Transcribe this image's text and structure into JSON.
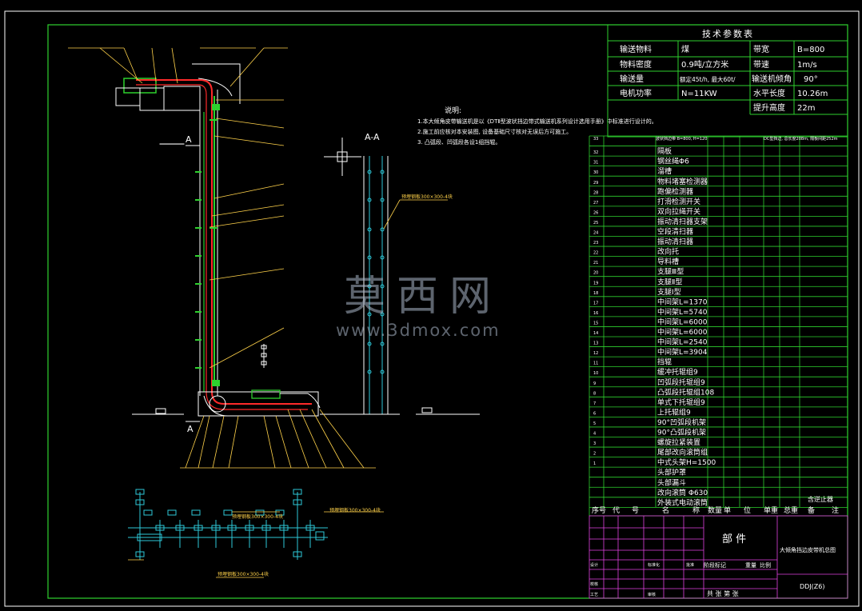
{
  "tech_table": {
    "title": "技术参数表",
    "rows": [
      {
        "k1": "输送物料",
        "v1": "煤",
        "k2": "带宽",
        "v2": "B=800"
      },
      {
        "k1": "物料密度",
        "v1": "0.9吨/立方米",
        "k2": "带速",
        "v2": "1m/s"
      },
      {
        "k1": "输送量",
        "v1": "额定45t/h, 最大60t/",
        "k2": "输送机倾角",
        "v2": "90°"
      },
      {
        "k1": "电机功率",
        "v1": "N=11KW",
        "k2": "水平长度",
        "v2": "10.26m"
      },
      {
        "k1": "",
        "v1": "",
        "k2": "提升高度",
        "v2": "22m"
      }
    ]
  },
  "notes": {
    "title": "说明:",
    "lines": [
      "1.本大倾角皮带输送机是以《DTⅡ型波状挡边带式输送机系列设计选用手册》中标准进行设计的。",
      "2.施工前应核对本安装图, 设备基础尺寸核对无误后方可施工。",
      "3. 凸弧段、凹弧段各设1组挡辊。"
    ]
  },
  "section_label": "A-A",
  "section_marks": [
    "A",
    "A"
  ],
  "annotations": [
    "预埋钢板300×300-4块",
    "预埋钢板300×300-4块",
    "预埋钢板300×300-4块",
    "预埋钢板300×300-4块"
  ],
  "bom": {
    "head_row": {
      "no": "33",
      "name": "波状挡边带 B=800, H=120",
      "remark": "DC型挡边, 总长度208m, 隔板间距252m"
    },
    "items": [
      {
        "no": "32",
        "name": "隔板"
      },
      {
        "no": "31",
        "name": "钢丝绳Φ6"
      },
      {
        "no": "30",
        "name": "溜槽"
      },
      {
        "no": "29",
        "name": "物料堵塞检测器"
      },
      {
        "no": "28",
        "name": "跑偏检测器"
      },
      {
        "no": "27",
        "name": "打滑检测开关"
      },
      {
        "no": "26",
        "name": "双向拉绳开关"
      },
      {
        "no": "25",
        "name": "振动清扫器支架"
      },
      {
        "no": "24",
        "name": "空段清扫器"
      },
      {
        "no": "23",
        "name": "振动清扫器"
      },
      {
        "no": "22",
        "name": "改向托"
      },
      {
        "no": "21",
        "name": "导料槽"
      },
      {
        "no": "20",
        "name": "支腿Ⅲ型"
      },
      {
        "no": "19",
        "name": "支腿Ⅱ型"
      },
      {
        "no": "18",
        "name": "支腿Ⅰ型"
      },
      {
        "no": "17",
        "name": "中间架L=1370"
      },
      {
        "no": "16",
        "name": "中间架L=5740"
      },
      {
        "no": "15",
        "name": "中间架L=6000"
      },
      {
        "no": "14",
        "name": "中间架L=6000"
      },
      {
        "no": "13",
        "name": "中间架L=2540"
      },
      {
        "no": "12",
        "name": "中间架L=3904"
      },
      {
        "no": "11",
        "name": "挡辊"
      },
      {
        "no": "10",
        "name": "缓冲托辊组9"
      },
      {
        "no": "9",
        "name": "凹弧段托辊组9"
      },
      {
        "no": "8",
        "name": "凸弧段托辊组108"
      },
      {
        "no": "7",
        "name": "单式下托辊组9"
      },
      {
        "no": "6",
        "name": "上托辊组9"
      },
      {
        "no": "5",
        "name": "90°凹弧段机架"
      },
      {
        "no": "4",
        "name": "90°凸弧段机架"
      },
      {
        "no": "3",
        "name": "螺旋拉紧装置"
      },
      {
        "no": "2",
        "name": "尾部改向滚筒组"
      },
      {
        "no": "1",
        "name": "中式头架H=1500"
      },
      {
        "no": "",
        "name": "头部护罩"
      },
      {
        "no": "",
        "name": "头部漏斗"
      },
      {
        "no": "",
        "name": "改向滚筒 Φ630"
      },
      {
        "no": "",
        "name": "外装式电动滚筒"
      }
    ],
    "last_remark": "含逆止器",
    "header": [
      "序号",
      "代",
      "号",
      "名",
      "称",
      "数量",
      "单",
      "位",
      "单重",
      "总重",
      "备",
      "注"
    ]
  },
  "title_block": {
    "part": "部 件",
    "drawing_name": "大倾角挡边皮带机总图",
    "code": "DDJ(Z6)",
    "stage": "阶段标记",
    "weight": "重量",
    "scale": "比例",
    "sheets": "共  张  第  张",
    "left_labels": [
      "设计",
      "校核",
      "工艺",
      "审核",
      "标准化",
      "批准"
    ]
  },
  "watermark": {
    "cn": "莫西网",
    "url": "www.3dmox.com"
  },
  "colors": {
    "frame": "#2ed12e",
    "belt": "#ff2a2a",
    "text": "#ffffff",
    "note": "#ffd24a",
    "dim": "#2ec8d8"
  }
}
